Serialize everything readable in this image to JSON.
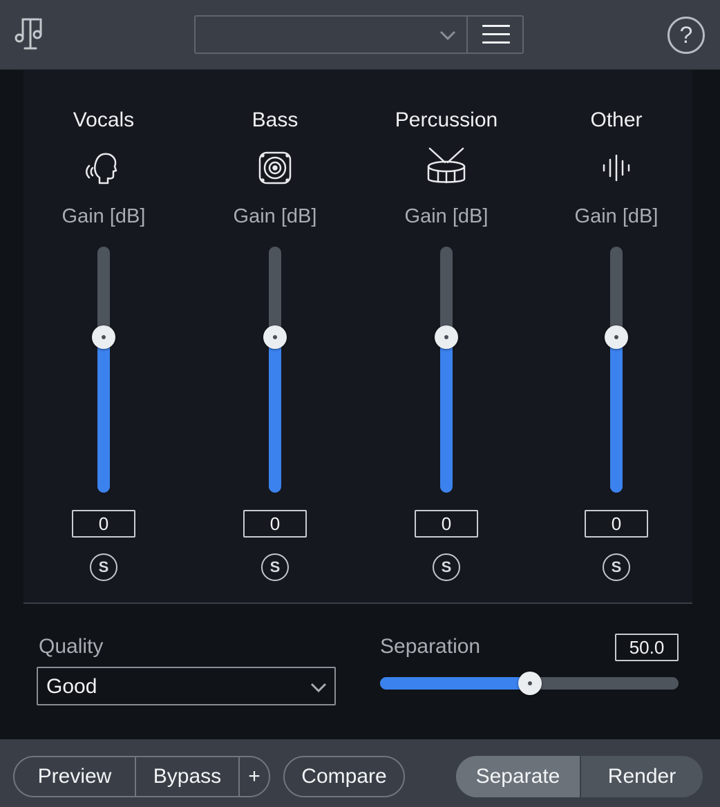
{
  "topbar": {
    "logo_icon": "music-notes-logo-icon",
    "preset": {
      "value": "",
      "chevron_icon": "chevron-down-icon",
      "menu_icon": "hamburger-menu-icon"
    },
    "help_label": "?"
  },
  "channels": [
    {
      "name": "Vocals",
      "icon": "voice-head-icon",
      "gain_label": "Gain [dB]",
      "value": "0",
      "level": 0.63,
      "solo_label": "S"
    },
    {
      "name": "Bass",
      "icon": "speaker-icon",
      "gain_label": "Gain [dB]",
      "value": "0",
      "level": 0.63,
      "solo_label": "S"
    },
    {
      "name": "Percussion",
      "icon": "drum-icon",
      "gain_label": "Gain [dB]",
      "value": "0",
      "level": 0.63,
      "solo_label": "S"
    },
    {
      "name": "Other",
      "icon": "waveform-icon",
      "gain_label": "Gain [dB]",
      "value": "0",
      "level": 0.63,
      "solo_label": "S"
    }
  ],
  "quality": {
    "label": "Quality",
    "value": "Good"
  },
  "separation": {
    "label": "Separation",
    "value": "50.0",
    "level": 0.5
  },
  "bottom": {
    "preview_label": "Preview",
    "bypass_label": "Bypass",
    "add_label": "+",
    "compare_label": "Compare",
    "separate_label": "Separate",
    "render_label": "Render"
  },
  "colors": {
    "accent": "#3b82ee",
    "panel": "#15181e",
    "bar": "#3a3f47"
  }
}
